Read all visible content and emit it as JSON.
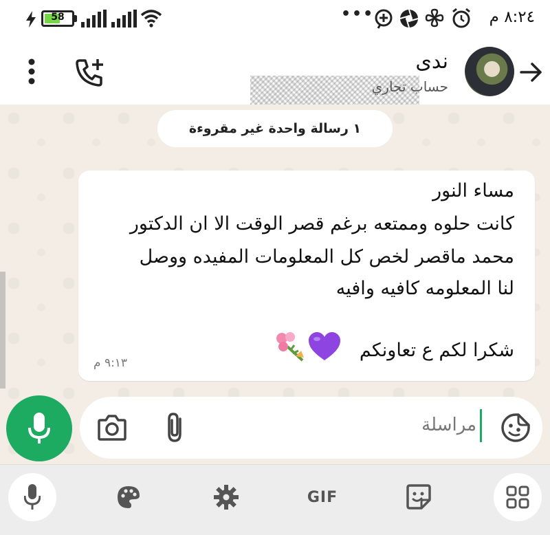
{
  "status_bar": {
    "time": "٨:٢٤ م",
    "battery": "58",
    "overflow_dots": "•••"
  },
  "header": {
    "contact_name": "ندى",
    "contact_subtitle": "حساب تجاري"
  },
  "chat": {
    "unread_banner": "١ رسالة واحدة غير مقروءة",
    "message": {
      "lines": [
        "مساء النور",
        "كانت حلوه وممتعه برغم قصر الوقت الا ان الدكتور",
        "محمد ماقصر لخص كل المعلومات المفيده ووصل",
        "لنا المعلومه كافيه وافيه",
        "شكرا لكم ع تعاونكم"
      ],
      "time": "٩:١٣ م"
    }
  },
  "composer": {
    "placeholder": "مراسلة"
  },
  "keyboard_toolbar": {
    "gif_label": "GIF"
  },
  "colors": {
    "accent_green": "#1daa61",
    "emoji_purple": "#8e44e0"
  }
}
